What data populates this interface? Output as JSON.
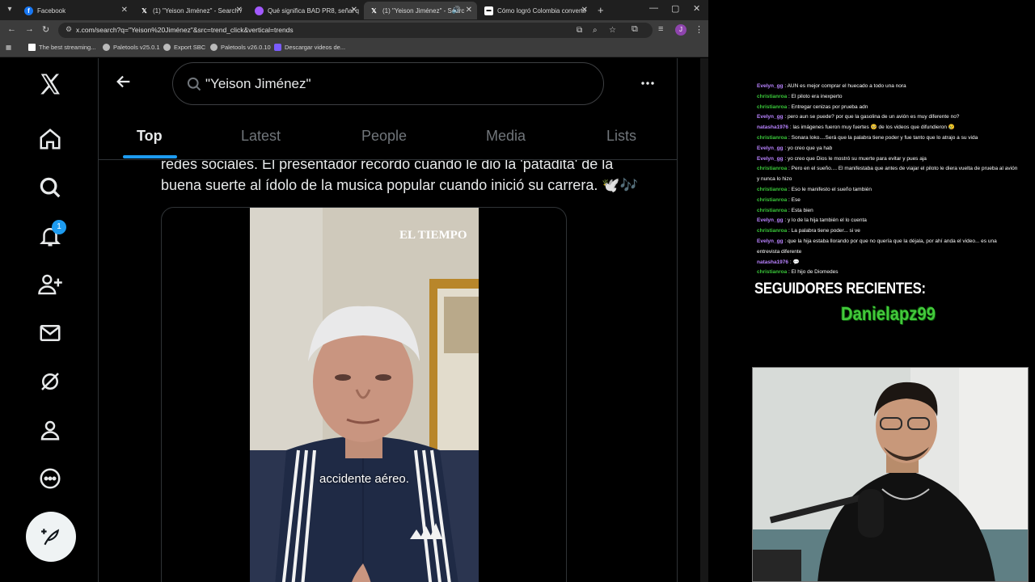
{
  "browser": {
    "tabs": [
      {
        "title": "Facebook",
        "favicon": "facebook-icon",
        "active": false
      },
      {
        "title": "(1) \"Yeison Jiménez\" - Search /",
        "favicon": "x-logo-icon",
        "active": false
      },
      {
        "title": "Qué significa BAD PR8, señal q",
        "favicon": "web-icon",
        "active": false
      },
      {
        "title": "(1) \"Yeison Jiménez\" - Searc",
        "favicon": "x-logo-icon",
        "active": true
      },
      {
        "title": "Cómo logró Colombia convertir",
        "favicon": "news-icon",
        "active": false
      }
    ],
    "url": "x.com/search?q=\"Yeison%20Jiménez\"&src=trend_click&vertical=trends",
    "bookmarks": [
      {
        "label": "The best streaming..."
      },
      {
        "label": "Paletools v25.0.1"
      },
      {
        "label": "Export SBC"
      },
      {
        "label": "Paletools v26.0.10"
      },
      {
        "label": "Descargar videos de..."
      }
    ],
    "profile_initial": "J",
    "accent_color": "#8e44ad"
  },
  "x": {
    "search_query": "\"Yeison Jiménez\"",
    "notification_count": "1",
    "tabs": [
      "Top",
      "Latest",
      "People",
      "Media",
      "Lists"
    ],
    "active_tab": "Top",
    "post_line1": "redes sociales. El presentador recordó cuando le dio la 'patadita' de la",
    "post_line2": "buena suerte al ídolo de la musica popular cuando inició su carrera. 🕊️🎶",
    "video_watermark": "EL TIEMPO",
    "video_subtitle": "accidente aéreo.",
    "brand_color": "#1d9bf0"
  },
  "overlay": {
    "chat": [
      {
        "user": "Evelyn_gg",
        "text": "AUN es mejor comprar el huecado a todo una nora",
        "color": "#b983ff"
      },
      {
        "user": "christianroa",
        "text": "El piloto era inexperto",
        "color": "#3ac83a"
      },
      {
        "user": "christianroa",
        "text": "Entregar cenizas por prueba adn",
        "color": "#3ac83a"
      },
      {
        "user": "Evelyn_gg",
        "text": "pero aun se puede? por que la gasolina de un avión es muy diferente no?",
        "color": "#b983ff"
      },
      {
        "user": "natasha1976",
        "text": "las imágenes fueron muy fuertes 🥺 de los videos que difundieron 😢",
        "color": "#b983ff"
      },
      {
        "user": "christianroa",
        "text": "Sonara loko....Será que la palabra tiene poder y fue tanto que lo atrajo a su vida",
        "color": "#3ac83a"
      },
      {
        "user": "Evelyn_gg",
        "text": "yo creo que ya hab",
        "color": "#b983ff"
      },
      {
        "user": "Evelyn_gg",
        "text": "yo creo que Dios le mostró su muerte para evitar y pues aja",
        "color": "#b983ff"
      },
      {
        "user": "christianroa",
        "text": "Pero en el sueño.... El manifestaba que antes de viajar el piloto le diera vuelta de prueba al avión",
        "color": "#3ac83a"
      },
      {
        "user": "",
        "text": "y nunca lo hizo",
        "color": "#ffffff"
      },
      {
        "user": "christianroa",
        "text": "Eso le manifesto el sueño también",
        "color": "#3ac83a"
      },
      {
        "user": "christianroa",
        "text": "Ese",
        "color": "#3ac83a"
      },
      {
        "user": "christianroa",
        "text": "Esta bien",
        "color": "#3ac83a"
      },
      {
        "user": "Evelyn_gg",
        "text": "y lo de la hija también el lo cuenta",
        "color": "#b983ff"
      },
      {
        "user": "christianroa",
        "text": "La palabra tiene poder... si ve",
        "color": "#3ac83a"
      },
      {
        "user": "Evelyn_gg",
        "text": "que la hija estaba llorando por que no quería que la déjala, por ahí anda el video... es una",
        "color": "#b983ff"
      },
      {
        "user": "",
        "text": "entrevista diferente",
        "color": "#ffffff"
      },
      {
        "user": "natasha1976",
        "text": "💬",
        "color": "#b983ff"
      },
      {
        "user": "christianroa",
        "text": "El hijo de Diomedes",
        "color": "#3ac83a"
      }
    ],
    "followers_title": "SEGUIDORES RECIENTES:",
    "recent_follower": "Danielapz99",
    "follower_color": "#43c93b"
  }
}
